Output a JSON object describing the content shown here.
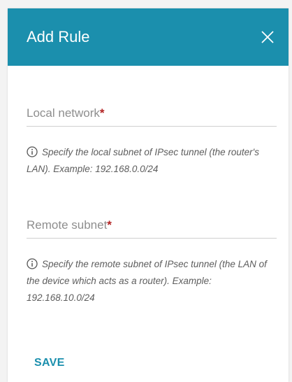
{
  "dialog": {
    "title": "Add Rule",
    "close_icon": "close-icon",
    "header_color": "#1b8fad"
  },
  "local_network": {
    "label": "Local network",
    "required_mark": "*",
    "value": "",
    "hint": "Specify the local subnet of IPsec tunnel (the router's LAN). Example: 192.168.0.0/24",
    "hint_icon": "info-icon"
  },
  "remote_subnet": {
    "label": "Remote subnet",
    "required_mark": "*",
    "value": "",
    "hint": "Specify the remote subnet of IPsec tunnel (the LAN of the device which acts as a router). Example: 192.168.10.0/24",
    "hint_icon": "info-icon"
  },
  "actions": {
    "save_label": "SAVE"
  }
}
